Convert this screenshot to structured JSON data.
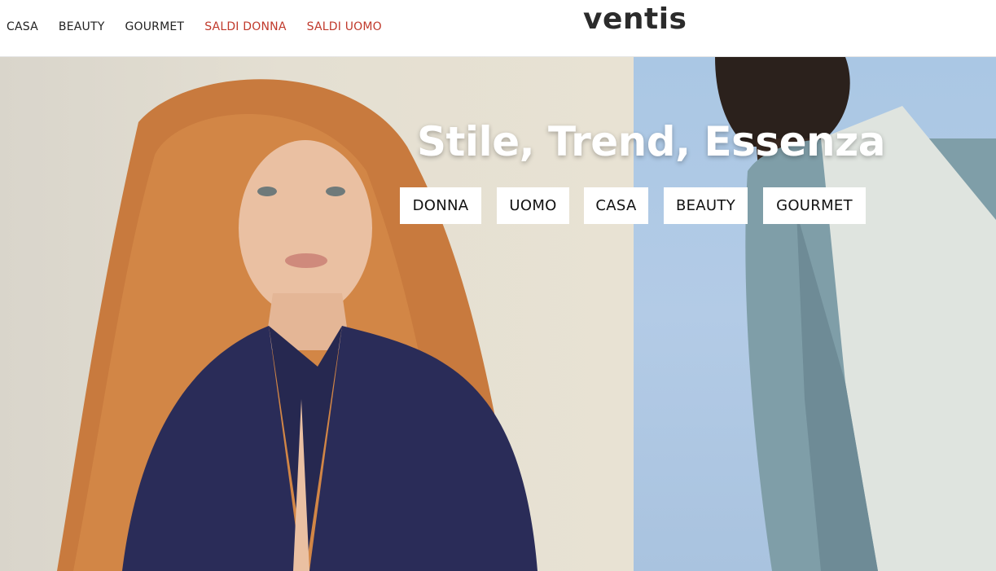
{
  "header": {
    "logo": "ventis",
    "nav": [
      {
        "label": "CASA",
        "sale": false
      },
      {
        "label": "BEAUTY",
        "sale": false
      },
      {
        "label": "GOURMET",
        "sale": false
      },
      {
        "label": "SALDI DONNA",
        "sale": true
      },
      {
        "label": "SALDI UOMO",
        "sale": true
      }
    ]
  },
  "hero": {
    "headline": "Stile, Trend, Essenza",
    "buttons": [
      "DONNA",
      "UOMO",
      "CASA",
      "BEAUTY",
      "GOURMET"
    ]
  },
  "colors": {
    "sale": "#c0392b",
    "text": "#222222",
    "logo": "#2b2b2b"
  }
}
